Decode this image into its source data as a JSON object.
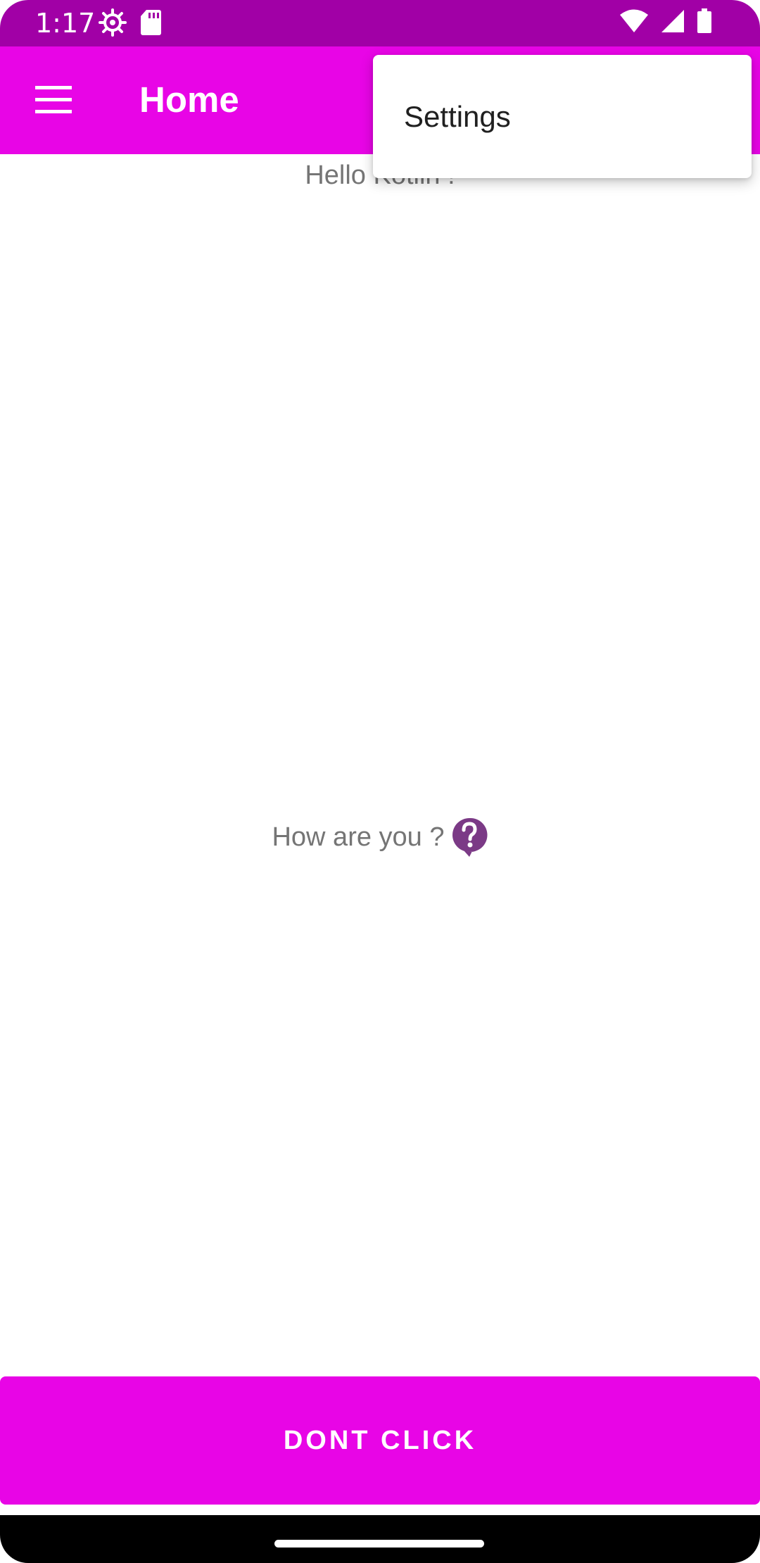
{
  "status_bar": {
    "time": "1:17",
    "left_icons": [
      "settings-gear-icon",
      "sd-card-icon"
    ],
    "right_icons": [
      "wifi-icon",
      "cell-signal-icon",
      "battery-icon"
    ],
    "color": "#a100a6"
  },
  "app_bar": {
    "title": "Home",
    "nav_icon": "hamburger-menu-icon",
    "color": "#e805e6"
  },
  "overflow_menu": {
    "items": [
      {
        "label": "Settings"
      }
    ]
  },
  "content": {
    "greeting": "Hello Kotlin !",
    "question": "How are you ?",
    "question_icon": "help-bubble-icon",
    "question_icon_color": "#7b3a86"
  },
  "bottom_button": {
    "label": "DONT CLICK",
    "color": "#e805e6"
  }
}
